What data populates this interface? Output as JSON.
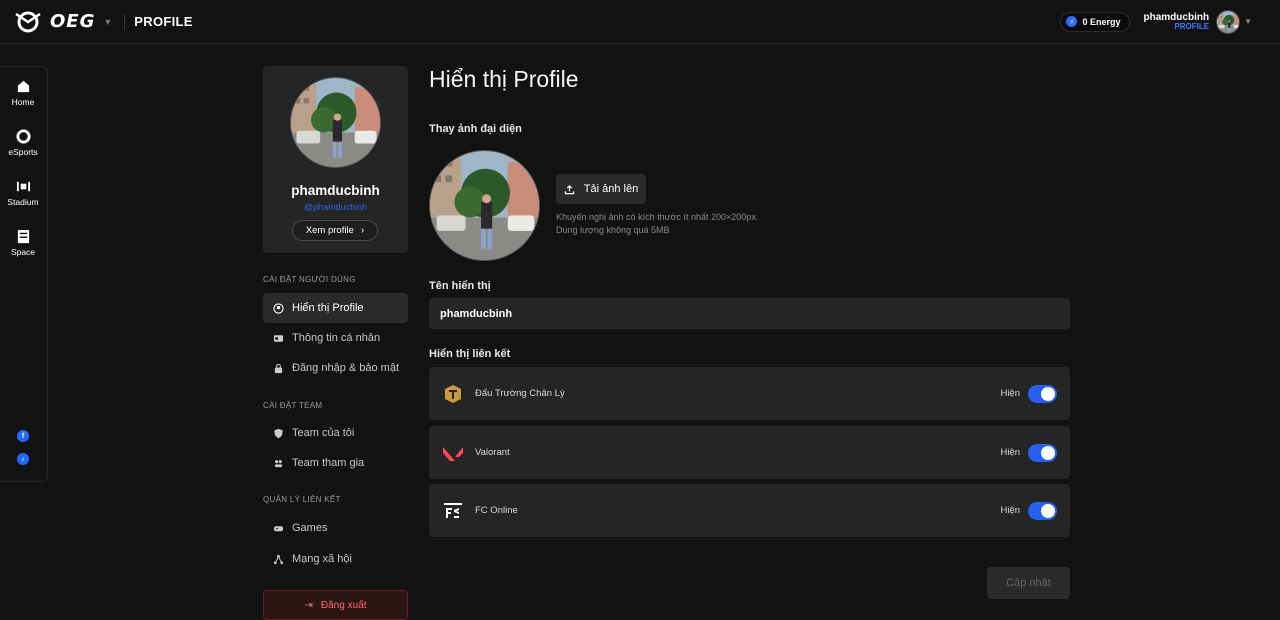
{
  "header": {
    "logo_text": "OEG",
    "page_label": "PROFILE",
    "energy_label": "0 Energy",
    "user_name": "phamducbinh",
    "user_sub": "PROFILE"
  },
  "rail": {
    "items": [
      {
        "label": "Home",
        "icon": "home-icon"
      },
      {
        "label": "eSports",
        "icon": "esports-icon"
      },
      {
        "label": "Stadium",
        "icon": "stadium-icon"
      },
      {
        "label": "Space",
        "icon": "space-icon"
      }
    ],
    "socials": [
      "facebook-icon",
      "tiktok-icon"
    ]
  },
  "profile_card": {
    "name": "phamducbinh",
    "handle": "@phamducbinh",
    "view_button": "Xem profile"
  },
  "settings_nav": {
    "sections": [
      {
        "title": "CÀI ĐẶT NGƯỜI DÙNG",
        "items": [
          {
            "label": "Hiển thị Profile",
            "icon": "user-circle-icon",
            "active": true
          },
          {
            "label": "Thông tin cá nhân",
            "icon": "id-card-icon",
            "active": false
          },
          {
            "label": "Đăng nhập & bảo mật",
            "icon": "lock-icon",
            "active": false
          }
        ]
      },
      {
        "title": "CÀI ĐẶT TEAM",
        "items": [
          {
            "label": "Team của tôi",
            "icon": "shield-icon",
            "active": false
          },
          {
            "label": "Team tham gia",
            "icon": "group-icon",
            "active": false
          }
        ]
      },
      {
        "title": "QUẢN LÝ LIÊN KẾT",
        "items": [
          {
            "label": "Games",
            "icon": "gamepad-icon",
            "active": false
          },
          {
            "label": "Mạng xã hội",
            "icon": "network-icon",
            "active": false
          }
        ]
      }
    ],
    "logout_label": "Đăng xuất"
  },
  "main": {
    "title": "Hiển thị Profile",
    "avatar_section_label": "Thay ảnh đại diện",
    "upload_label": "Tải ảnh lên",
    "hint_line1": "Khuyến nghị ảnh có kích thước ít nhất 200×200px.",
    "hint_line2": "Dung lượng không quá 5MB",
    "display_name_label": "Tên hiển thị",
    "display_name_value": "phamducbinh",
    "links_label": "Hiển thị liên kết",
    "links": [
      {
        "name": "Đấu Trường Chân Lý",
        "state": "Hiện",
        "enabled": true,
        "icon": "tft-icon"
      },
      {
        "name": "Valorant",
        "state": "Hiện",
        "enabled": true,
        "icon": "valorant-icon"
      },
      {
        "name": "FC Online",
        "state": "Hiện",
        "enabled": true,
        "icon": "fc-online-icon"
      }
    ],
    "save_label": "Cập nhật"
  },
  "colors": {
    "accent": "#2560ef",
    "background": "#121212",
    "card": "#252525",
    "danger": "#ff6b6b"
  }
}
